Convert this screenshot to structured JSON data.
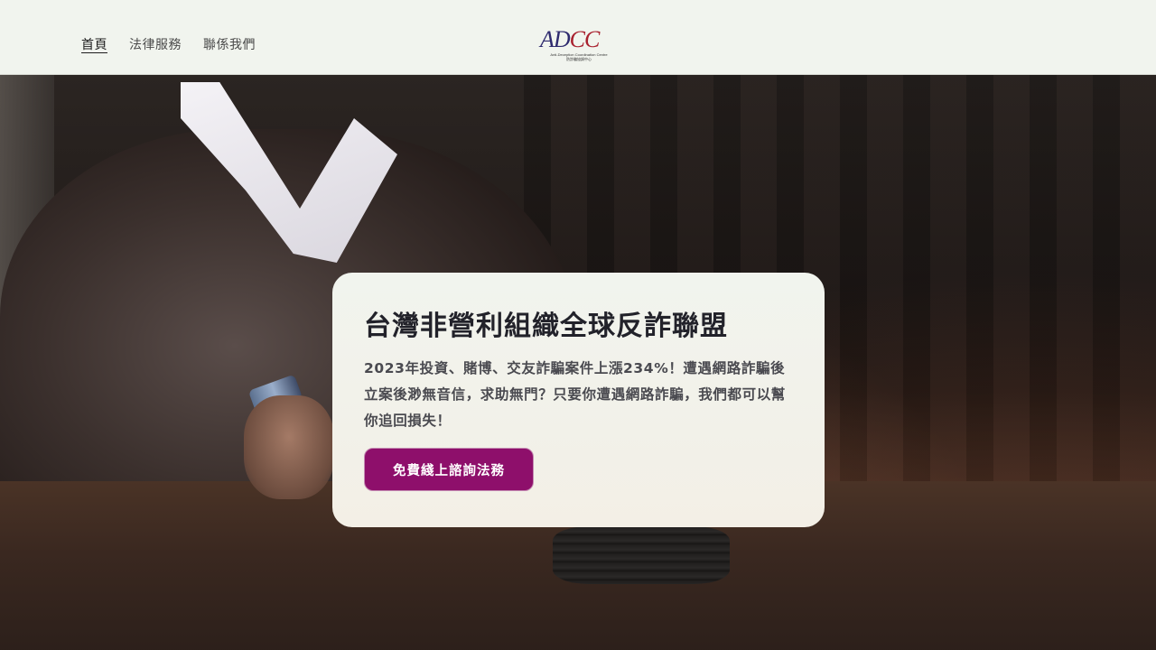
{
  "header": {
    "nav": [
      {
        "label": "首頁",
        "active": true
      },
      {
        "label": "法律服務",
        "active": false
      },
      {
        "label": "聯係我們",
        "active": false
      }
    ],
    "logo": {
      "mark_a": "AD",
      "mark_b": "CC",
      "subtitle_en": "Anti-Deception Coordination Centre",
      "subtitle_zh": "防詐騙協調中心"
    }
  },
  "hero": {
    "title": "台灣非營利組織全球反詐聯盟",
    "description": "2023年投資、賭博、交友詐騙案件上漲234%！遭遇網路詐騙後立案後渺無音信，求助無門？只要你遭遇網路詐騙，我們都可以幫你追回損失！",
    "cta_label": "免費綫上諮詢法務"
  },
  "colors": {
    "header_bg": "#f1f4ee",
    "cta_bg": "#8e0f6b",
    "title_text": "#22222a"
  }
}
